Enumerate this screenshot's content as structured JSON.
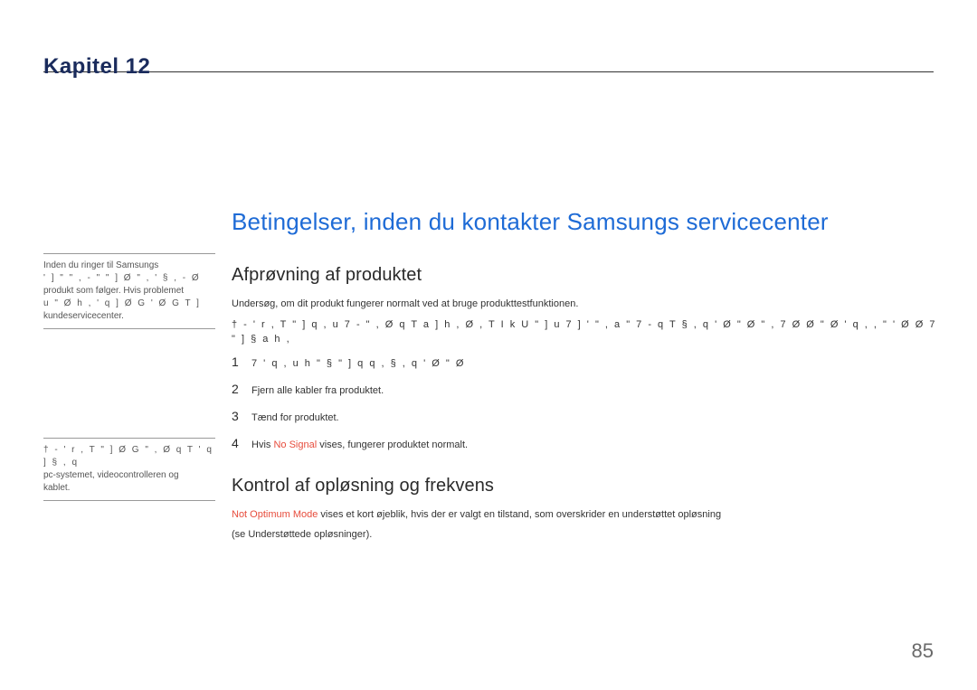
{
  "chapter": {
    "title": "Kapitel 12"
  },
  "sidebar": {
    "block1_line1": "Inden du ringer til Samsungs",
    "block1_line2": "' ] \" \" , -  \" \" ] Ø \" , '  § , -  Ø",
    "block1_line3": "produkt som følger. Hvis problemet",
    "block1_line4": "u \"  Ø h , '  q ] Ø G ' Ø  G T  ]",
    "block1_line5": "kundeservicecenter.",
    "block2_line1": "† -   ' r , T \" ]  Ø G   \" , Ø q T '  q ] § , q",
    "block2_line2": "pc-systemet, videocontrolleren og",
    "block2_line3": "kablet."
  },
  "main": {
    "h1": "Betingelser, inden du kontakter Samsungs servicecenter",
    "section1": {
      "h2": "Afprøvning af produktet",
      "p1": "Undersøg, om dit produkt fungerer normalt ved at bruge produkttestfunktionen.",
      "p2": "† -   ' r , T \" ]  q , u 7  - \" ,  Ø q T a  ] h ,  Ø ,  T  I k U  \" ]  u 7  ] ' \" , a   \" 7 - q T  § , q   ' Ø \" Ø  \" ,   7  Ø Ø \" Ø  ' q , , \" ' Ø  Ø  7  \" ]  §  a   h     ,",
      "steps": {
        "s1": "7  '   q ,  u h  \"  §   \" ]  q    q ,  § , q   ' Ø \" Ø",
        "s2": "Fjern alle kabler fra produktet.",
        "s3": "Tænd for produktet.",
        "s4_prefix": "Hvis ",
        "s4_red": "No Signal",
        "s4_suffix": " vises, fungerer produktet normalt."
      }
    },
    "section2": {
      "h2": "Kontrol af opløsning og frekvens",
      "p1_red": "Not Optimum Mode",
      "p1_rest": " vises et kort øjeblik, hvis der er valgt en tilstand, som overskrider en understøttet opløsning",
      "p2": "(se Understøttede opløsninger)."
    }
  },
  "page": "85"
}
